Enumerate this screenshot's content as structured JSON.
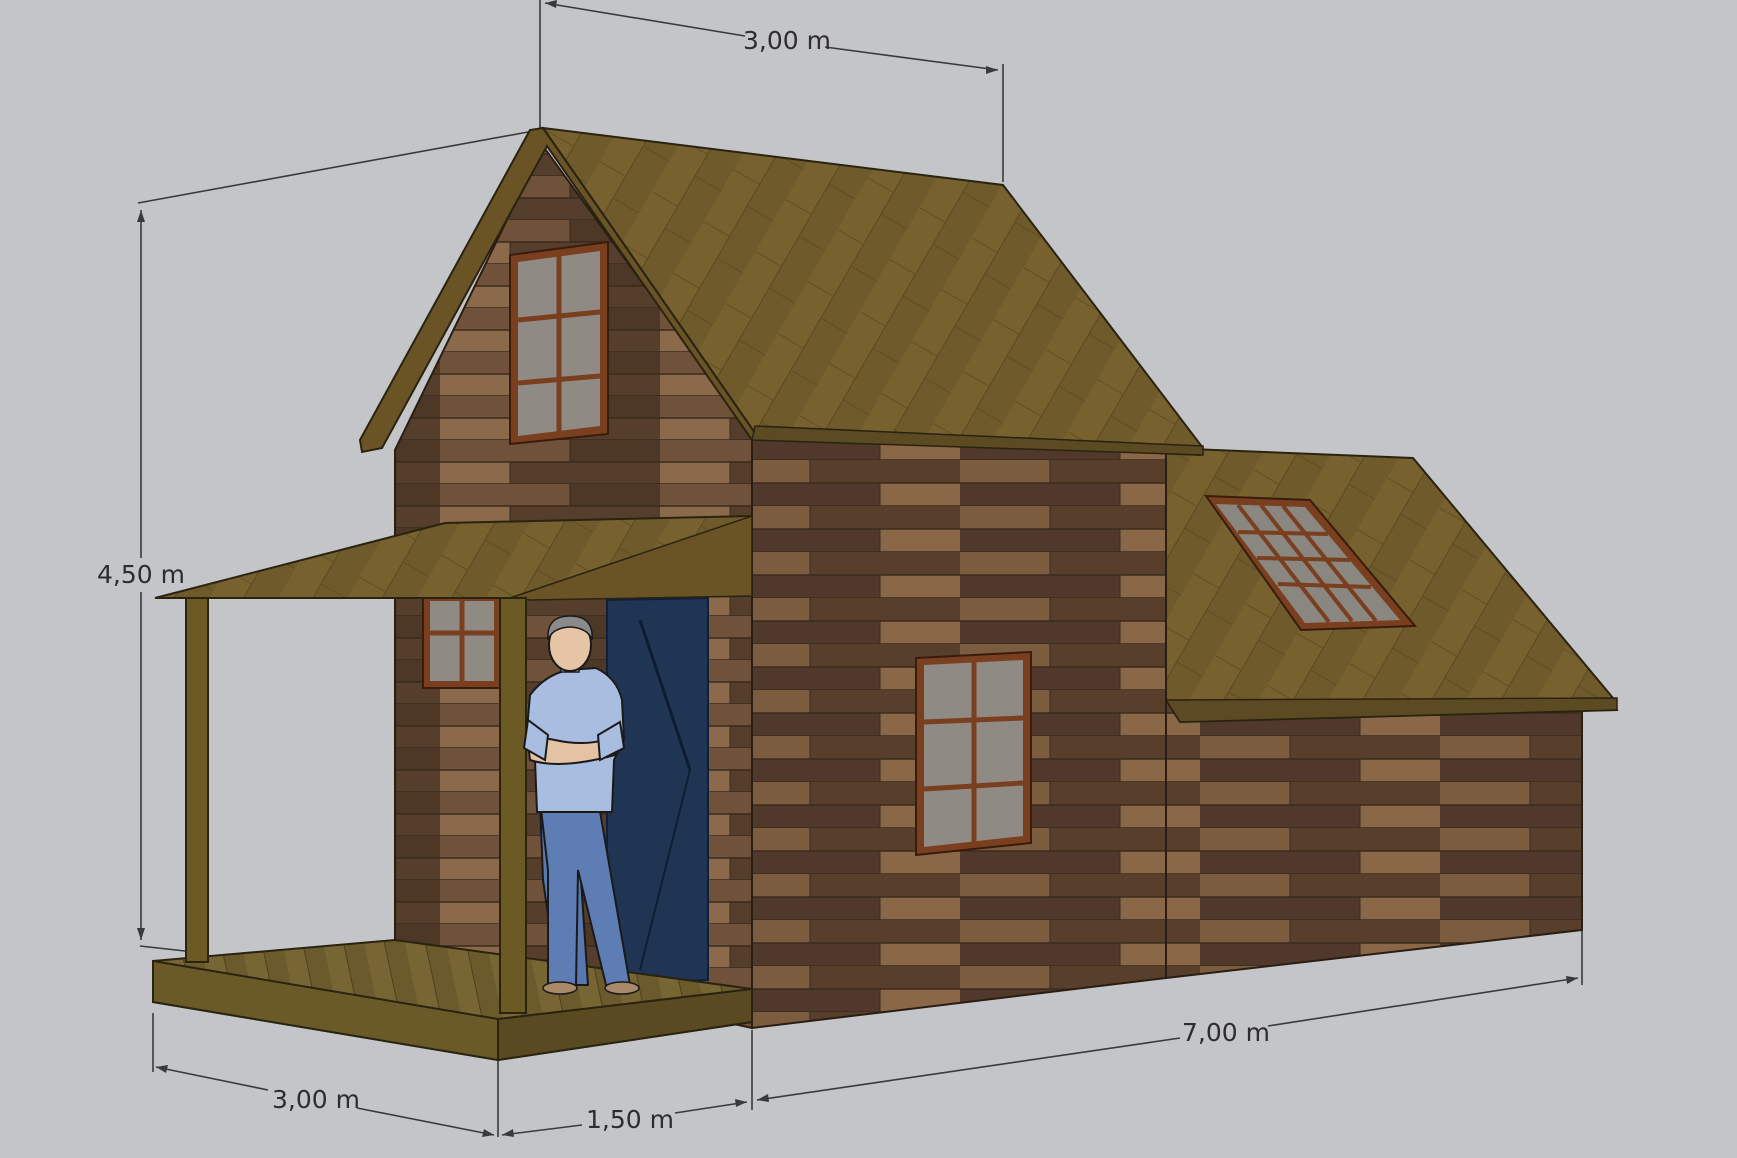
{
  "dimensions": {
    "roof_width": "3,00 m",
    "total_height": "4,50 m",
    "porch_width": "3,00 m",
    "porch_depth": "1,50 m",
    "house_length": "7,00 m"
  },
  "colors": {
    "background": "#c4c5c9",
    "wood_dark": "#4e3a2a",
    "wood_mid": "#6d5038",
    "wood_light": "#8c6a48",
    "roof": "#6e5a2a",
    "roof_light": "#86703a",
    "door": "#1f3553",
    "window_frame": "#7a3f1f",
    "window_glass": "#9a9590",
    "dimension_line": "#3a3a3a"
  }
}
